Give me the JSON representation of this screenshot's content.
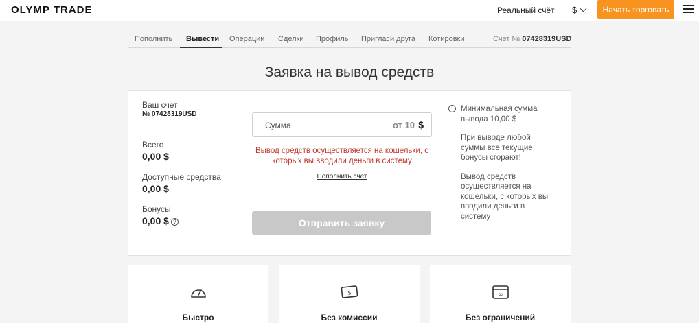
{
  "header": {
    "logo": "OLYMP TRADE",
    "account_type": "Реальный счёт",
    "currency": "$",
    "start_trading": "Начать торговать"
  },
  "tabs": [
    {
      "label": "Пополнить"
    },
    {
      "label": "Вывести",
      "active": true
    },
    {
      "label": "Операции"
    },
    {
      "label": "Сделки"
    },
    {
      "label": "Профиль"
    },
    {
      "label": "Пригласи друга"
    },
    {
      "label": "Котировки"
    }
  ],
  "account_number": {
    "prefix": "Счет №",
    "value": "07428319USD"
  },
  "page_title": "Заявка на вывод средств",
  "summary": {
    "account_label": "Ваш счет",
    "account_value": "№ 07428319USD",
    "total_label": "Всего",
    "total_value": "0,00 $",
    "available_label": "Доступные средства",
    "available_value": "0,00 $",
    "bonus_label": "Бонусы",
    "bonus_value": "0,00 $"
  },
  "form": {
    "amount_placeholder": "Сумма",
    "amount_min": "от 10",
    "amount_currency": "$",
    "warning": "Вывод средств осуществляется на кошельки, с которых вы вводили деньги в систему",
    "deposit_link": "Пополнить счет",
    "submit_label": "Отправить заявку"
  },
  "info": [
    "Минимальная сумма вывода 10,00 $",
    "При выводе любой суммы все текущие бонусы сгорают!",
    "Вывод средств осуществляется на кошельки, с которых вы вводили деньги в систему"
  ],
  "features": [
    {
      "label": "Быстро",
      "icon": "speedometer-icon"
    },
    {
      "label": "Без комиссии",
      "icon": "banknote-icon"
    },
    {
      "label": "Без ограничений",
      "icon": "card-infinity-icon"
    }
  ],
  "colors": {
    "accent": "#f7931e",
    "warning": "#c0392b",
    "disabled_button": "#c8c8c8",
    "logo_o": "#2a9a40"
  }
}
